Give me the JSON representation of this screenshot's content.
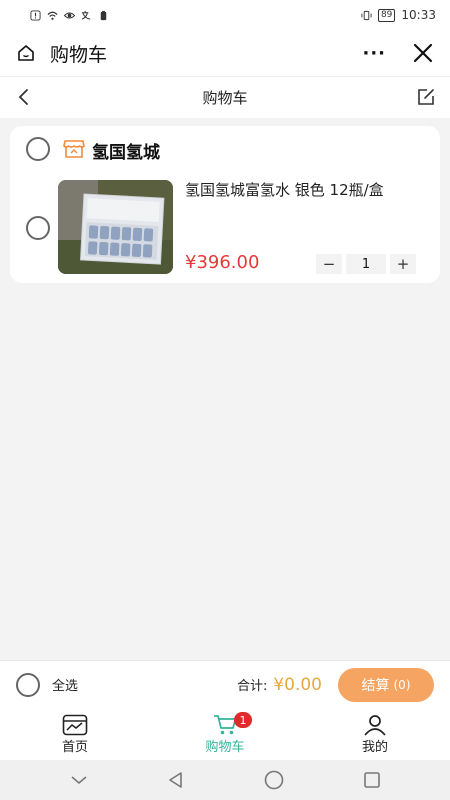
{
  "status_bar": {
    "time": "10:33",
    "battery": "89"
  },
  "header": {
    "title": "购物车",
    "more_label": "···"
  },
  "page_nav": {
    "title": "购物车"
  },
  "cart": {
    "shop_name": "氢国氢城",
    "items": [
      {
        "title": "氢国氢城富氢水 银色 12瓶/盒",
        "price": "¥396.00",
        "quantity": "1",
        "minus": "−",
        "plus": "+"
      }
    ]
  },
  "checkout": {
    "select_all_label": "全选",
    "total_label": "合计:",
    "total_value": "¥0.00",
    "button_label": "结算",
    "button_count": "(0)"
  },
  "tabs": [
    {
      "label": "首页",
      "icon": "home-icon"
    },
    {
      "label": "购物车",
      "icon": "cart-icon",
      "badge": "1"
    },
    {
      "label": "我的",
      "icon": "user-icon"
    }
  ],
  "colors": {
    "accent": "#33b59b",
    "price": "#e63a3a",
    "checkout": "#f6a461",
    "total": "#e8a83f",
    "shop_icon": "#f08a3c"
  }
}
